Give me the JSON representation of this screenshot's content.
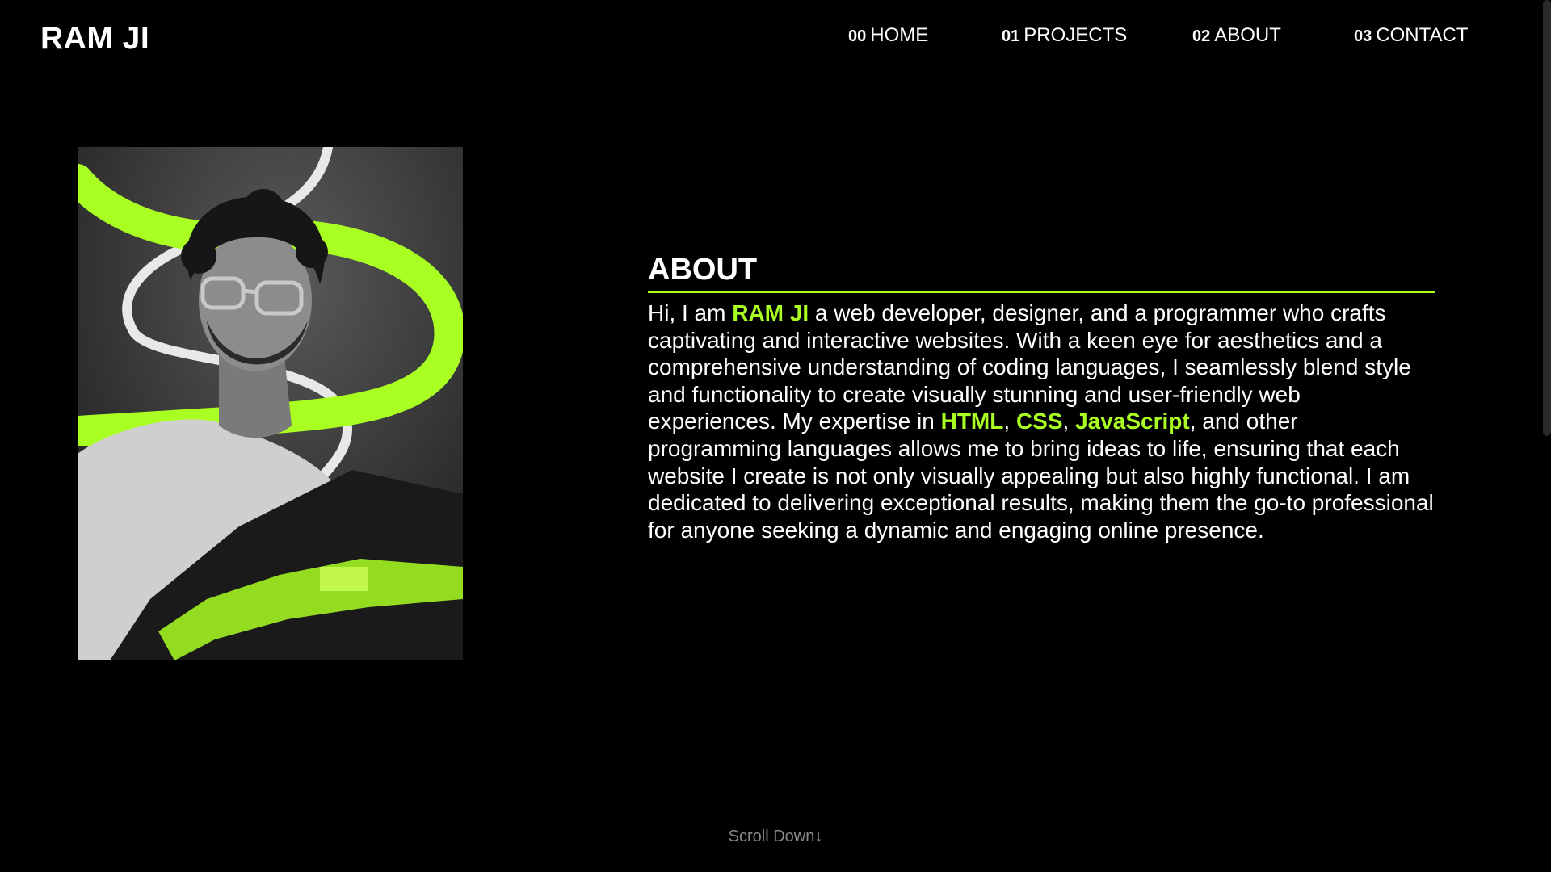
{
  "brand": "RAM JI",
  "nav": [
    {
      "num": "00",
      "label": "HOME"
    },
    {
      "num": "01",
      "label": "PROJECTS"
    },
    {
      "num": "02",
      "label": "ABOUT"
    },
    {
      "num": "03",
      "label": "CONTACT"
    }
  ],
  "about": {
    "heading": "ABOUT",
    "p1": "Hi, I am ",
    "name": "RAM JI",
    "p2": " a web developer, designer, and a programmer who crafts captivating and interactive websites. With a keen eye for aesthetics and a comprehensive understanding of coding languages, I seamlessly blend style and functionality to create visually stunning and user-friendly web experiences. My expertise in ",
    "skill1": "HTML",
    "sep1": ", ",
    "skill2": "CSS",
    "sep2": ", ",
    "skill3": "JavaScript",
    "p3": ", and other programming languages allows me to bring ideas to life, ensuring that each website I create is not only visually appealing but also highly functional. I am dedicated to delivering exceptional results, making them the go-to professional for anyone seeking a dynamic and engaging online presence."
  },
  "scroll_label": "Scroll Down↓",
  "colors": {
    "accent": "#aaff22",
    "background": "#000000",
    "text": "#ffffff"
  }
}
